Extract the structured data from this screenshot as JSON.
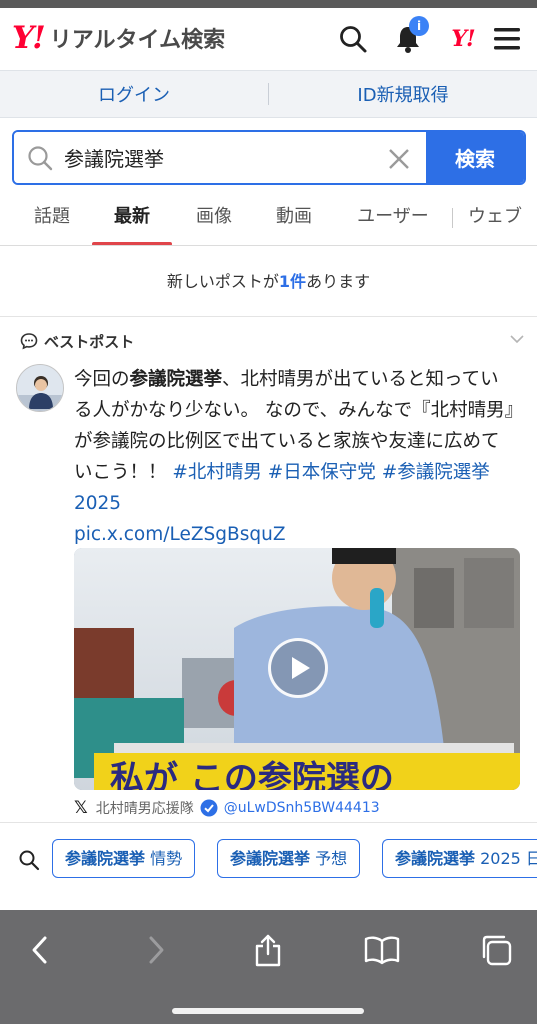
{
  "header": {
    "logo_mark": "Y!",
    "logo_text": "リアルタイム検索",
    "notification_badge": "i",
    "yahoo_mark": "Y!"
  },
  "auth": {
    "login_label": "ログイン",
    "register_label": "ID新規取得"
  },
  "search": {
    "query": "参議院選挙",
    "button_label": "検索"
  },
  "tabs": [
    {
      "label": "話題",
      "active": false
    },
    {
      "label": "最新",
      "active": true
    },
    {
      "label": "画像",
      "active": false
    },
    {
      "label": "動画",
      "active": false
    },
    {
      "label": "ユーザー",
      "active": false
    },
    {
      "label": "ウェブ",
      "active": false
    }
  ],
  "new_posts": {
    "prefix": "新しいポストが",
    "count": "1件",
    "suffix": "あります"
  },
  "best_post": {
    "section_label": "ベストポスト",
    "text_pre": "今回の",
    "text_bold": "参議院選挙",
    "text_body": "、北村晴男が出ていると知っている人がかなり少ない。 なので、みんなで『北村晴男』が参議院の比例区で出ていると家族や友達に広めていこう！！ ",
    "tag1": "#北村晴男",
    "tag2": "#日本保守党",
    "tag3": "#参議院選挙2025",
    "link": "pic.x.com/LeZSgBsquZ",
    "video_caption": "私が この参院選の",
    "author_name": "北村晴男応援隊",
    "author_handle": "@uLwDSnh5BW44413",
    "source_icon": "x-logo-icon"
  },
  "related": [
    {
      "bold": "参議院選挙",
      "rest": " 情勢"
    },
    {
      "bold": "参議院選挙",
      "rest": " 予想"
    },
    {
      "bold": "参議院選挙",
      "rest": " 2025 日"
    }
  ],
  "colors": {
    "brand_red": "#ff0033",
    "accent_blue": "#2d6fe6",
    "tab_underline": "#e0454a",
    "toolbar_gray": "#6b6b6d"
  }
}
